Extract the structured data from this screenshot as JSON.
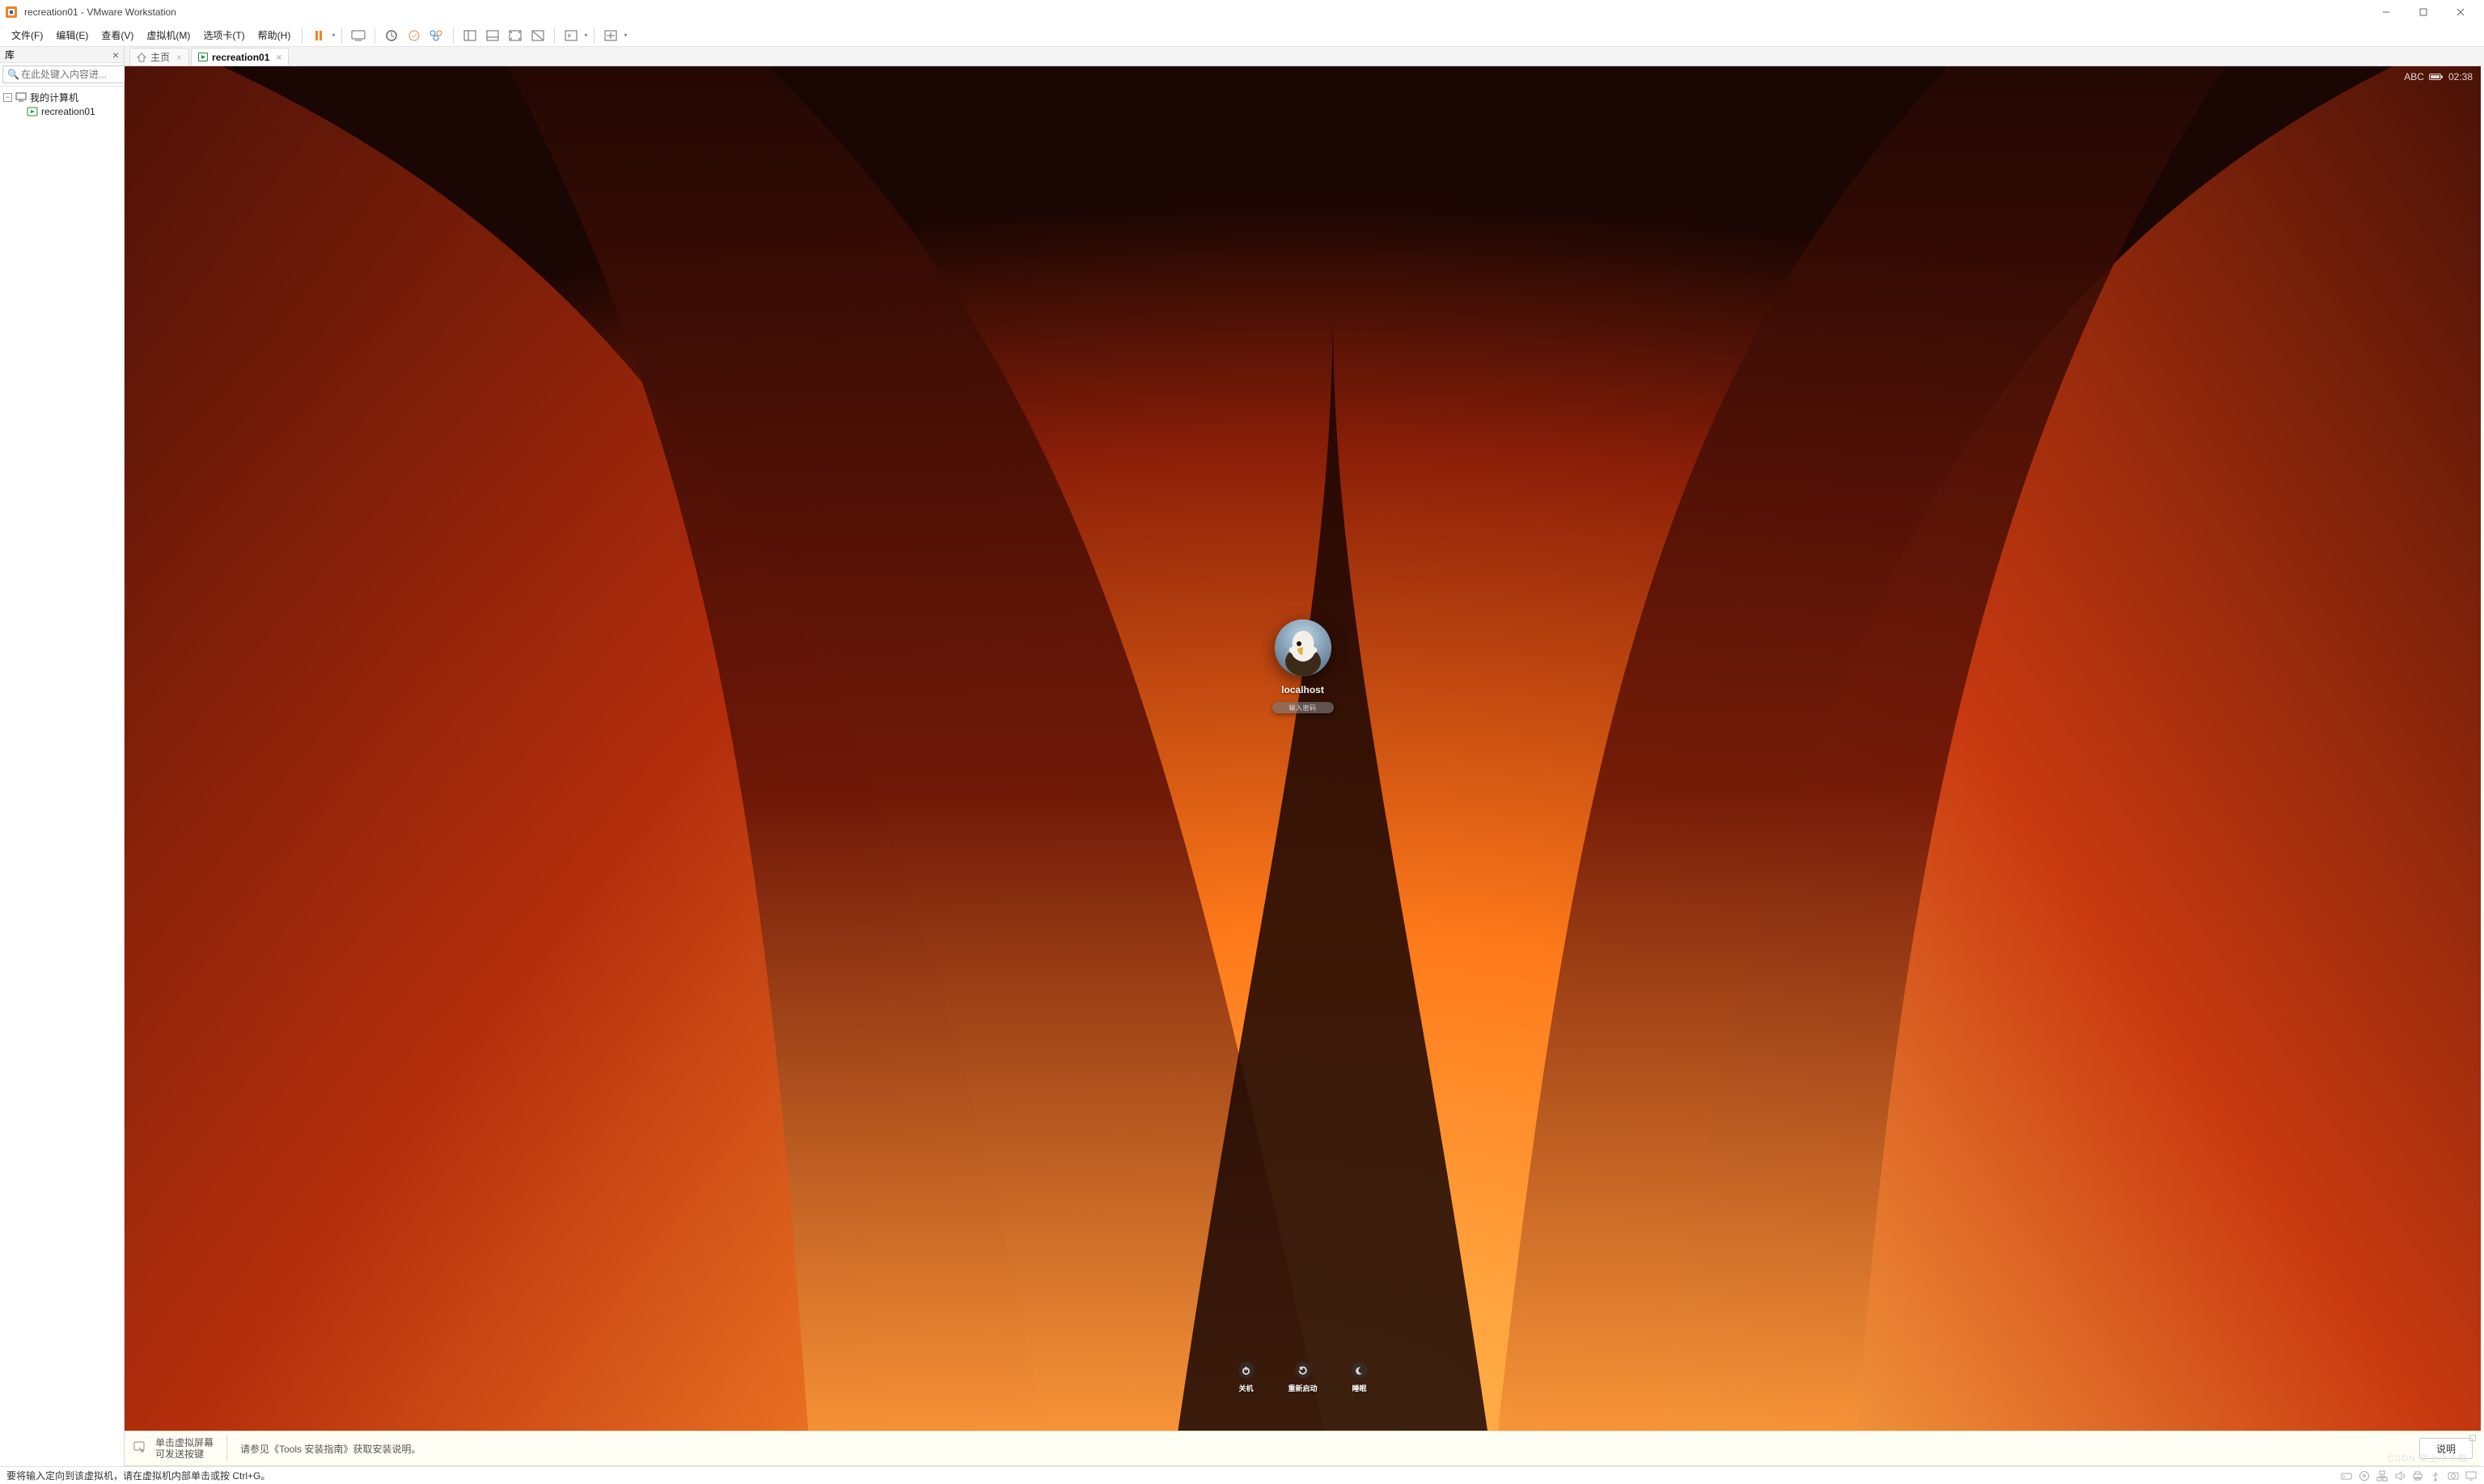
{
  "titlebar": {
    "title": "recreation01 - VMware Workstation"
  },
  "menu": {
    "file": "文件(F)",
    "edit": "编辑(E)",
    "view": "查看(V)",
    "vm": "虚拟机(M)",
    "tabs": "选项卡(T)",
    "help": "帮助(H)"
  },
  "sidebar": {
    "header": "库",
    "search_placeholder": "在此处键入内容进...",
    "root": "我的计算机",
    "child": "recreation01"
  },
  "tabs_row": {
    "home": "主页",
    "vm": "recreation01"
  },
  "guest": {
    "menu_abc": "ABC",
    "time": "02:38",
    "username": "localhost",
    "password_placeholder": "输入密码",
    "power": {
      "shutdown": "关机",
      "restart": "重新启动",
      "sleep": "睡眠"
    }
  },
  "hint": {
    "line1": "单击虚拟屏幕",
    "line2": "可发送按键",
    "tools_prefix": "请参见《",
    "tools_link": "Tools 安装指南",
    "tools_suffix": "》获取安装说明。",
    "desc_btn": "说明"
  },
  "status": {
    "text": "要将输入定向到该虚拟机，请在虚拟机内部单击或按 Ctrl+G。"
  },
  "watermark": "CSDN 文上小小脑"
}
